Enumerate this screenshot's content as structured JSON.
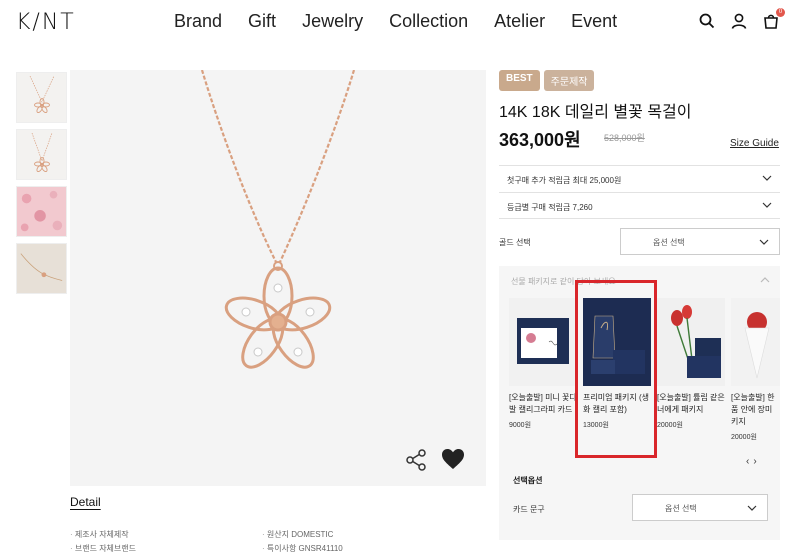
{
  "header": {
    "logo": "K/NT",
    "nav": [
      "Brand",
      "Gift",
      "Jewelry",
      "Collection",
      "Atelier",
      "Event"
    ],
    "cart_count": "0"
  },
  "product": {
    "badges": [
      "BEST",
      "주문제작"
    ],
    "title": "14K 18K 데일리 별꽃 목걸이",
    "price": "363,000원",
    "old_price": "528,000원",
    "size_guide": "Size Guide",
    "accordions": [
      "첫구매 추가 적립금 최대 25,000원",
      "등급별 구매 적립금 7,260"
    ],
    "gold_label": "골드 선택",
    "select_placeholder": "옵션 선택"
  },
  "package": {
    "heading": "선물 패키지로 같이 담아 보세요",
    "items": [
      {
        "name": "[오늘출발] 미니 꽃다발 캘리그라피 카드",
        "price": "9000원"
      },
      {
        "name": "프리미엄 패키지 (생화 캘리 포함)",
        "price": "13000원"
      },
      {
        "name": "[오늘출발] 튤립 같은 너에게 패키지",
        "price": "20000원"
      },
      {
        "name": "[오늘출발] 한 품 안에 장미 키지",
        "price": "20000원"
      }
    ],
    "option_label": "선택옵션",
    "card_label": "카드 문구",
    "card_placeholder": "옵션 선택"
  },
  "detail": {
    "tab": "Detail",
    "specs_left": [
      "제조사 자체제작",
      "브랜드 자체브랜드"
    ],
    "specs_right": [
      "원산지 DOMESTIC",
      "특이사항 GNSR41110"
    ]
  },
  "colors": {
    "accent": "#d9262b",
    "badge": "#c9a98c",
    "rose_gold": "#d9a080"
  }
}
